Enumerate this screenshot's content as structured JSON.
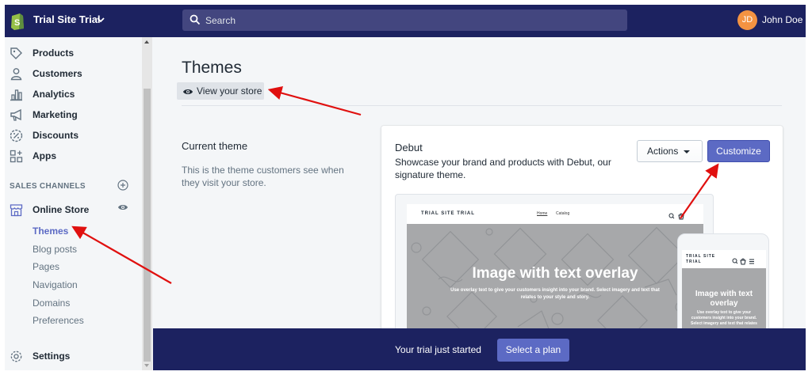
{
  "topbar": {
    "store_name": "Trial Site Trial",
    "search_placeholder": "Search",
    "avatar_initials": "JD",
    "user_name": "John Doe"
  },
  "sidebar": {
    "items": [
      {
        "label": "Products",
        "icon": "tag-icon"
      },
      {
        "label": "Customers",
        "icon": "person-icon"
      },
      {
        "label": "Analytics",
        "icon": "bar-chart-icon"
      },
      {
        "label": "Marketing",
        "icon": "megaphone-icon"
      },
      {
        "label": "Discounts",
        "icon": "discount-icon"
      },
      {
        "label": "Apps",
        "icon": "apps-icon"
      }
    ],
    "sales_channels_header": "SALES CHANNELS",
    "online_store": {
      "label": "Online Store",
      "sub_items": [
        "Themes",
        "Blog posts",
        "Pages",
        "Navigation",
        "Domains",
        "Preferences"
      ]
    },
    "settings_label": "Settings"
  },
  "main": {
    "page_title": "Themes",
    "view_store_label": "View your store",
    "current_theme_heading": "Current theme",
    "current_theme_desc": "This is the theme customers see when they visit your store.",
    "theme": {
      "name": "Debut",
      "description": "Showcase your brand and products with Debut, our signature theme.",
      "actions_label": "Actions",
      "customize_label": "Customize",
      "preview": {
        "store_name": "TRIAL SITE TRIAL",
        "nav_home": "Home",
        "nav_catalog": "Catalog",
        "hero_title": "Image with text overlay",
        "hero_text": "Use overlay text to give your customers insight into your brand. Select imagery and text that relates to your style and story.",
        "mobile_store_name": "TRIAL SITE TRIAL",
        "mobile_hero_title": "Image with text overlay",
        "mobile_hero_text": "Use overlay text to give your customers insight into your brand. Select imagery and text that relates"
      }
    }
  },
  "trial_bar": {
    "text": "Your trial just started",
    "button_label": "Select a plan"
  },
  "colors": {
    "topbar": "#1c2260",
    "accent": "#5c6ac4",
    "annotation_arrow": "#e0100f"
  }
}
